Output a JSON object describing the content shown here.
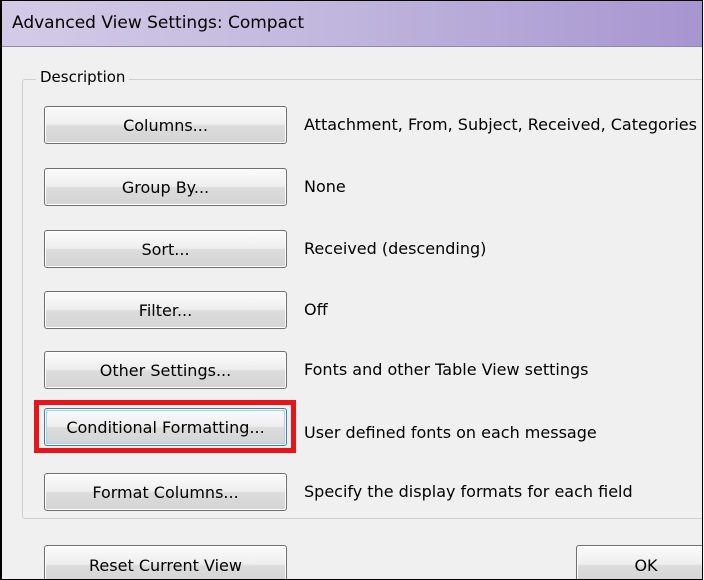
{
  "window": {
    "title": "Advanced View Settings: Compact"
  },
  "description_group": {
    "label": "Description",
    "rows": [
      {
        "button_label": "Columns...",
        "value": "Attachment, From, Subject, Received, Categories"
      },
      {
        "button_label": "Group By...",
        "value": "None"
      },
      {
        "button_label": "Sort...",
        "value": "Received (descending)"
      },
      {
        "button_label": "Filter...",
        "value": "Off"
      },
      {
        "button_label": "Other Settings...",
        "value": "Fonts and other Table View settings"
      },
      {
        "button_label": "Conditional Formatting...",
        "value": "User defined fonts on each message"
      },
      {
        "button_label": "Format Columns...",
        "value": "Specify the display formats for each field"
      }
    ]
  },
  "footer": {
    "reset_label": "Reset Current View",
    "ok_label": "OK"
  },
  "annotation": {
    "highlight_color": "#e8141a"
  }
}
